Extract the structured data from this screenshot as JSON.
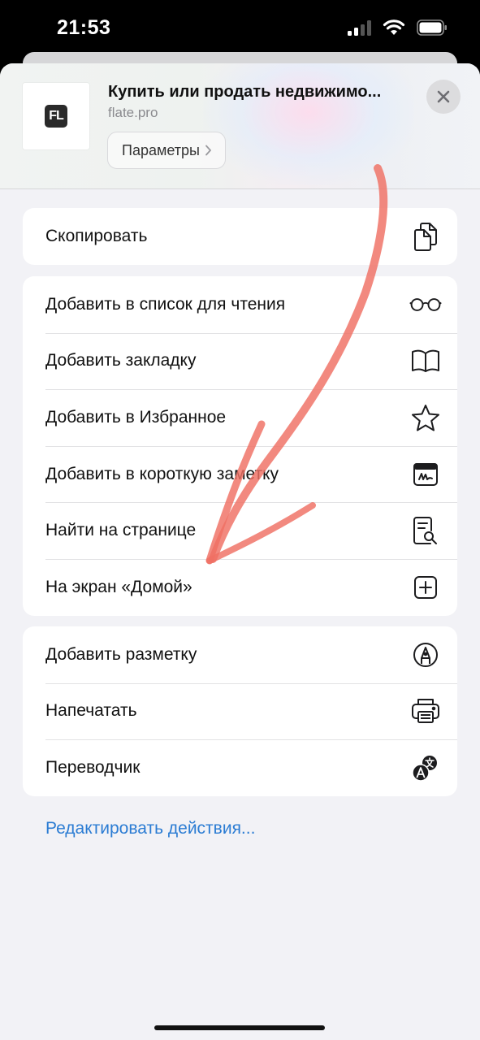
{
  "status_bar": {
    "time": "21:53"
  },
  "header": {
    "title": "Купить или продать недвижимо...",
    "domain": "flate.pro",
    "logo_text": "FL",
    "options_label": "Параметры"
  },
  "groups": [
    {
      "items": [
        {
          "label": "Скопировать",
          "icon": "copy-icon"
        }
      ]
    },
    {
      "items": [
        {
          "label": "Добавить в список для чтения",
          "icon": "glasses-icon"
        },
        {
          "label": "Добавить закладку",
          "icon": "book-icon"
        },
        {
          "label": "Добавить в Избранное",
          "icon": "star-icon"
        },
        {
          "label": "Добавить в короткую заметку",
          "icon": "quick-note-icon"
        },
        {
          "label": "Найти на странице",
          "icon": "find-on-page-icon"
        },
        {
          "label": "На экран «Домой»",
          "icon": "add-square-icon"
        }
      ]
    },
    {
      "items": [
        {
          "label": "Добавить разметку",
          "icon": "markup-pen-icon"
        },
        {
          "label": "Напечатать",
          "icon": "printer-icon"
        },
        {
          "label": "Переводчик",
          "icon": "translate-icon"
        }
      ]
    }
  ],
  "edit_actions_label": "Редактировать действия...",
  "colors": {
    "link": "#2b7cd3",
    "sheet_background": "#f2f2f6",
    "annotation_stroke": "#ef6f63"
  }
}
